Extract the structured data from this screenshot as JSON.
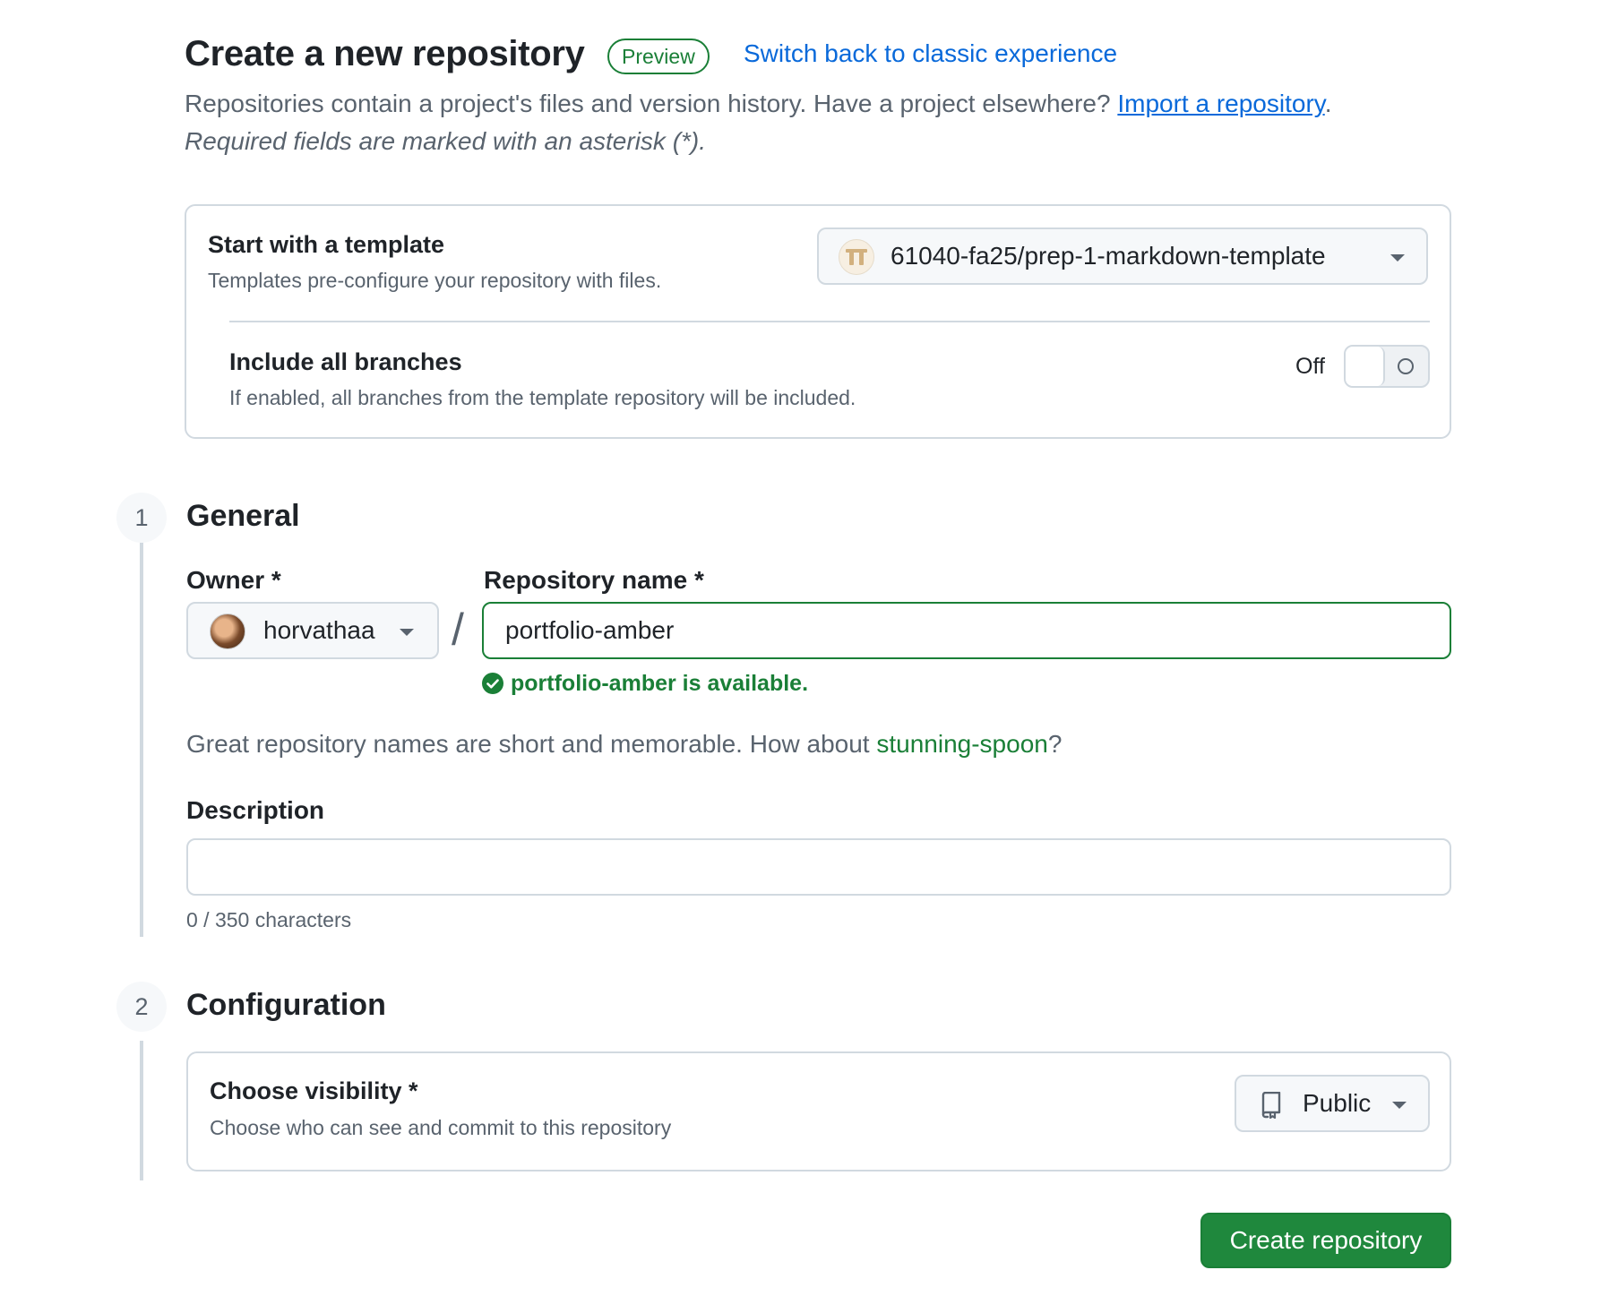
{
  "header": {
    "title": "Create a new repository",
    "badge": "Preview",
    "classic_link": "Switch back to classic experience",
    "intro_text": "Repositories contain a project's files and version history. Have a project elsewhere? ",
    "import_link": "Import a repository",
    "intro_end": ".",
    "required_note": "Required fields are marked with an asterisk (*)."
  },
  "template": {
    "title": "Start with a template",
    "description": "Templates pre-configure your repository with files.",
    "selected": "61040-fa25/prep-1-markdown-template",
    "include_branches": {
      "title": "Include all branches",
      "description": "If enabled, all branches from the template repository will be included.",
      "state_label": "Off"
    }
  },
  "general": {
    "step": "1",
    "title": "General",
    "owner_label": "Owner *",
    "owner_value": "horvathaa",
    "separator": "/",
    "repo_name_label": "Repository name *",
    "repo_name_value": "portfolio-amber",
    "availability": "portfolio-amber is available.",
    "suggestion_prefix": "Great repository names are short and memorable. How about ",
    "suggestion_name": "stunning-spoon",
    "suggestion_suffix": "?",
    "description_label": "Description",
    "description_value": "",
    "char_count": "0 / 350 characters"
  },
  "configuration": {
    "step": "2",
    "title": "Configuration",
    "visibility_title": "Choose visibility *",
    "visibility_description": "Choose who can see and commit to this repository",
    "visibility_value": "Public"
  },
  "actions": {
    "create_label": "Create repository"
  },
  "colors": {
    "accent_green": "#1f883d",
    "link_blue": "#0969da",
    "success_green": "#1a7f37",
    "muted_text": "#59636e",
    "border": "#d1d9e0"
  }
}
